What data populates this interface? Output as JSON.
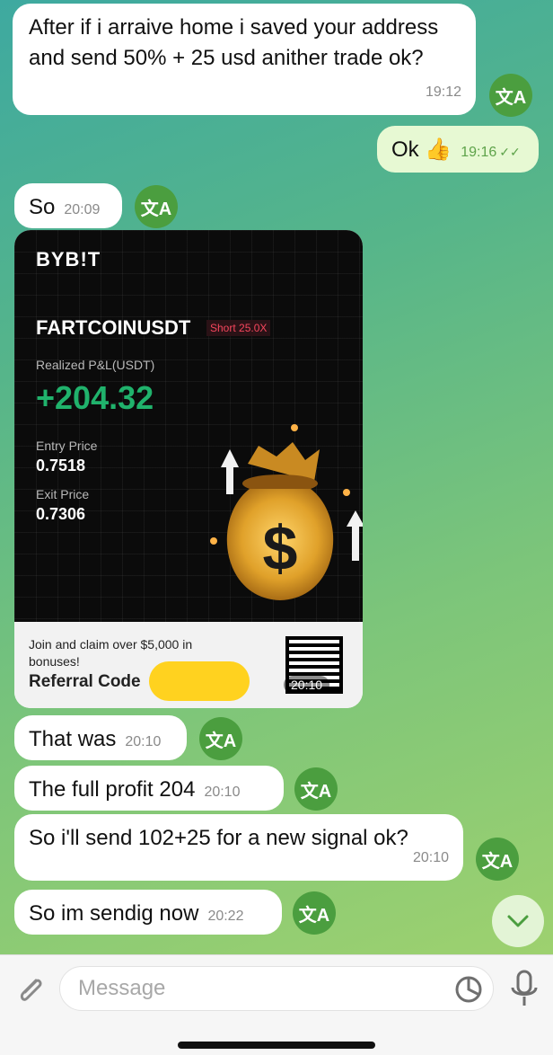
{
  "messages": [
    {
      "text": "After if i arraive home i saved your address and send 50% + 25 usd anither trade ok?",
      "time": "19:12"
    },
    {
      "text": "Ok 👍",
      "time": "19:16",
      "status": "✓✓"
    },
    {
      "text": "So",
      "time": "20:09"
    },
    {
      "text": "That was",
      "time": "20:10"
    },
    {
      "text": "The full profit 204",
      "time": "20:10"
    },
    {
      "text": "So i'll send 102+25 for a new signal ok?",
      "time": "20:10"
    },
    {
      "text": "So im sendig now",
      "time": "20:22"
    }
  ],
  "translate_icon": "文A",
  "card": {
    "brand": "BYB!T",
    "pair": "FARTCOINUSDT",
    "position_tag": "Short 25.0X",
    "pnl_label": "Realized P&L(USDT)",
    "pnl_value": "+204.32",
    "entry_label": "Entry Price",
    "entry_value": "0.7518",
    "exit_label": "Exit Price",
    "exit_value": "0.7306",
    "promo": "Join and claim over $5,000 in bonuses!",
    "referral_label": "Referral Code",
    "time": "20:10"
  },
  "composer": {
    "placeholder": "Message"
  },
  "colors": {
    "translate": "#4b9e3f",
    "pnl_green": "#20b26c",
    "short_red": "#f6465d"
  }
}
